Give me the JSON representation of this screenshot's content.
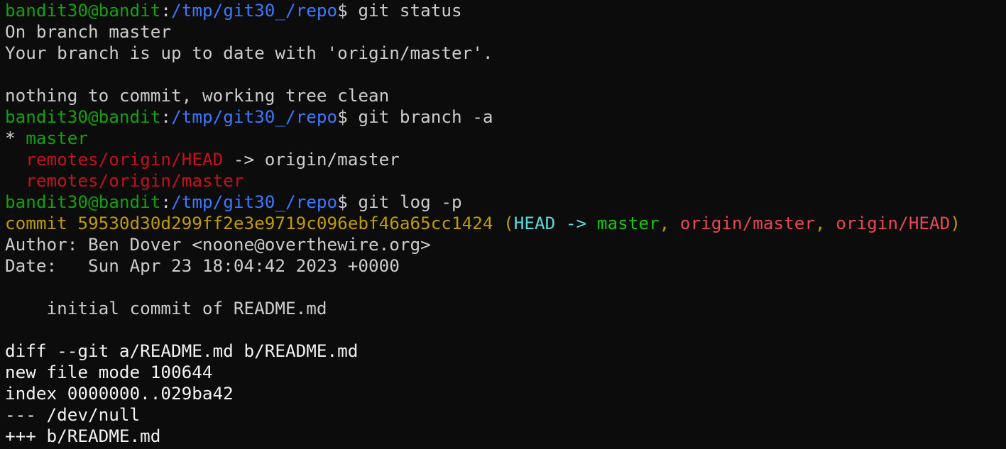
{
  "prompt": {
    "user_host": "bandit30@bandit",
    "colon": ":",
    "path": "/tmp/git30_/repo",
    "dollar": "$ "
  },
  "lines": {
    "cmd1": "git status",
    "status1": "On branch master",
    "status2": "Your branch is up to date with 'origin/master'.",
    "status3": "nothing to commit, working tree clean",
    "cmd2": "git branch -a",
    "branch_star": "* ",
    "branch_master": "master",
    "branch_indent": "  ",
    "branch_remote_head": "remotes/origin/HEAD",
    "branch_remote_head_arrow": " -> origin/master",
    "branch_remote_master": "remotes/origin/master",
    "cmd3": "git log -p",
    "commit_prefix": "commit 59530d30d299ff2e3e9719c096ebf46a65cc1424",
    "commit_open": " (",
    "commit_head": "HEAD -> ",
    "commit_master": "master",
    "commit_sep1": ", ",
    "commit_origin_master": "origin/master",
    "commit_sep2": ", ",
    "commit_origin_head": "origin/HEAD",
    "commit_close": ")",
    "author": "Author: Ben Dover <noone@overthewire.org>",
    "date": "Date:   Sun Apr 23 18:04:42 2023 +0000",
    "message": "    initial commit of README.md",
    "diff1": "diff --git a/README.md b/README.md",
    "diff2": "new file mode 100644",
    "diff3": "index 0000000..029ba42",
    "diff4": "--- /dev/null",
    "diff5": "+++ b/README.md"
  },
  "colors": {
    "background": "#0c0c0c",
    "prompt_user": "#13a10e",
    "prompt_path": "#3b78ff",
    "text": "#cccccc",
    "remote_branch": "#c50f1f",
    "commit_hash": "#c19c00",
    "ref_head": "#61d6d6",
    "ref_local": "#16c60c",
    "ref_remote": "#e74856"
  }
}
